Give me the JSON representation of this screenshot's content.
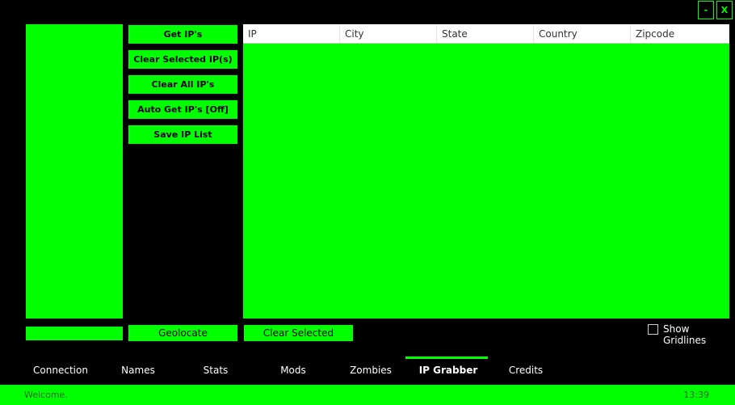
{
  "window": {
    "minimize_label": "-",
    "close_label": "X"
  },
  "actions": {
    "get_ips": "Get IP's",
    "clear_selected_ips": "Clear Selected IP(s)",
    "clear_all_ips": "Clear All IP's",
    "auto_get_ips": "Auto Get IP's [Off]",
    "save_ip_list": "Save IP List",
    "geolocate": "Geolocate",
    "clear_selected": "Clear Selected"
  },
  "table": {
    "columns": [
      "IP",
      "City",
      "State",
      "Country",
      "Zipcode"
    ],
    "rows": []
  },
  "options": {
    "show_gridlines_label": "Show Gridlines",
    "show_gridlines_checked": false
  },
  "tabs": [
    "Connection",
    "Names",
    "Stats",
    "Mods",
    "Zombies",
    "IP Grabber",
    "Credits"
  ],
  "active_tab": "IP Grabber",
  "status": {
    "message": "Welcome.",
    "time": "13:39"
  },
  "colors": {
    "accent": "#00ff00",
    "background": "#000000",
    "header": "#ffffff"
  }
}
